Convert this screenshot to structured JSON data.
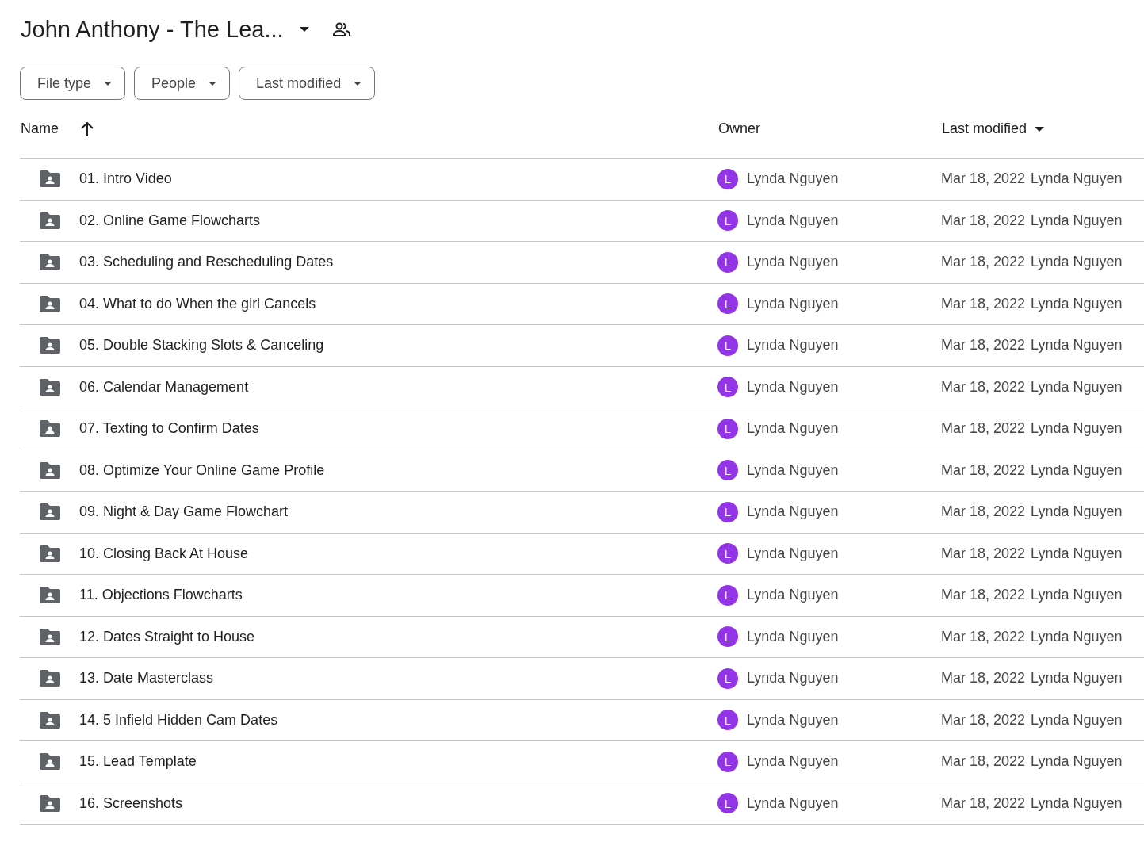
{
  "header": {
    "title": "John Anthony - The Lea..."
  },
  "filters": [
    {
      "label": "File type"
    },
    {
      "label": "People"
    },
    {
      "label": "Last modified"
    }
  ],
  "table": {
    "columns": [
      {
        "label": "Name",
        "sorted": true,
        "menu": false
      },
      {
        "label": "Owner",
        "sorted": false,
        "menu": false
      },
      {
        "label": "Last modified",
        "sorted": false,
        "menu": true
      }
    ],
    "rows": [
      {
        "name": "01. Intro Video",
        "avatar": "L",
        "owner": "Lynda Nguyen",
        "date": "Mar 18, 2022",
        "modified_by": "Lynda Nguyen"
      },
      {
        "name": "02. Online Game Flowcharts",
        "avatar": "L",
        "owner": "Lynda Nguyen",
        "date": "Mar 18, 2022",
        "modified_by": "Lynda Nguyen"
      },
      {
        "name": "03. Scheduling and Rescheduling Dates",
        "avatar": "L",
        "owner": "Lynda Nguyen",
        "date": "Mar 18, 2022",
        "modified_by": "Lynda Nguyen"
      },
      {
        "name": "04. What to do When the girl Cancels",
        "avatar": "L",
        "owner": "Lynda Nguyen",
        "date": "Mar 18, 2022",
        "modified_by": "Lynda Nguyen"
      },
      {
        "name": "05. Double Stacking Slots & Canceling",
        "avatar": "L",
        "owner": "Lynda Nguyen",
        "date": "Mar 18, 2022",
        "modified_by": "Lynda Nguyen"
      },
      {
        "name": "06. Calendar Management",
        "avatar": "L",
        "owner": "Lynda Nguyen",
        "date": "Mar 18, 2022",
        "modified_by": "Lynda Nguyen"
      },
      {
        "name": "07. Texting to Confirm Dates",
        "avatar": "L",
        "owner": "Lynda Nguyen",
        "date": "Mar 18, 2022",
        "modified_by": "Lynda Nguyen"
      },
      {
        "name": "08. Optimize Your Online Game Profile",
        "avatar": "L",
        "owner": "Lynda Nguyen",
        "date": "Mar 18, 2022",
        "modified_by": "Lynda Nguyen"
      },
      {
        "name": "09. Night & Day Game Flowchart",
        "avatar": "L",
        "owner": "Lynda Nguyen",
        "date": "Mar 18, 2022",
        "modified_by": "Lynda Nguyen"
      },
      {
        "name": "10. Closing Back At House",
        "avatar": "L",
        "owner": "Lynda Nguyen",
        "date": "Mar 18, 2022",
        "modified_by": "Lynda Nguyen"
      },
      {
        "name": "11. Objections Flowcharts",
        "avatar": "L",
        "owner": "Lynda Nguyen",
        "date": "Mar 18, 2022",
        "modified_by": "Lynda Nguyen"
      },
      {
        "name": "12. Dates Straight to House",
        "avatar": "L",
        "owner": "Lynda Nguyen",
        "date": "Mar 18, 2022",
        "modified_by": "Lynda Nguyen"
      },
      {
        "name": "13. Date Masterclass",
        "avatar": "L",
        "owner": "Lynda Nguyen",
        "date": "Mar 18, 2022",
        "modified_by": "Lynda Nguyen"
      },
      {
        "name": "14. 5 Infield Hidden Cam Dates",
        "avatar": "L",
        "owner": "Lynda Nguyen",
        "date": "Mar 18, 2022",
        "modified_by": "Lynda Nguyen"
      },
      {
        "name": "15. Lead Template",
        "avatar": "L",
        "owner": "Lynda Nguyen",
        "date": "Mar 18, 2022",
        "modified_by": "Lynda Nguyen"
      },
      {
        "name": "16. Screenshots",
        "avatar": "L",
        "owner": "Lynda Nguyen",
        "date": "Mar 18, 2022",
        "modified_by": "Lynda Nguyen"
      }
    ]
  }
}
